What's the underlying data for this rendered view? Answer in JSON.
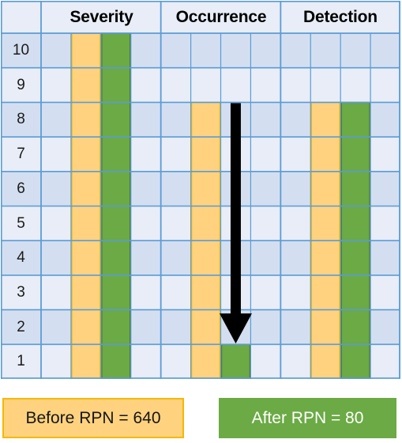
{
  "chart_data": {
    "type": "bar",
    "title": "",
    "xlabel": "",
    "ylabel": "",
    "ylim": [
      0,
      10
    ],
    "grid": true,
    "legend_position": "bottom",
    "categories": [
      "Severity",
      "Occurrence",
      "Detection"
    ],
    "tick_labels": [
      "10",
      "9",
      "8",
      "7",
      "6",
      "5",
      "4",
      "3",
      "2",
      "1"
    ],
    "series": [
      {
        "name": "Before RPN = 640",
        "color": "#FFD27F",
        "values": [
          10,
          8,
          8
        ]
      },
      {
        "name": "After RPN = 80",
        "color": "#6BAA45",
        "values": [
          10,
          1,
          8
        ]
      }
    ],
    "annotations": [
      {
        "type": "down-arrow",
        "category": "Occurrence",
        "series": "After RPN = 80",
        "from_value": 8,
        "to_value": 1,
        "color": "#000000"
      }
    ],
    "computed": {
      "before_rpn": 640,
      "after_rpn": 80
    }
  },
  "header": {
    "corner_label": "",
    "columns": [
      {
        "label": "Severity"
      },
      {
        "label": "Occurrence"
      },
      {
        "label": "Detection"
      }
    ]
  },
  "axis": {
    "row_labels": [
      "10",
      "9",
      "8",
      "7",
      "6",
      "5",
      "4",
      "3",
      "2",
      "1"
    ]
  },
  "legend": {
    "before": {
      "label": "Before RPN = 640",
      "fill": "#FFD27F",
      "stroke": "#F5B800",
      "text_color": "#161616"
    },
    "after": {
      "label": "After RPN = 80",
      "fill": "#6BAA45",
      "stroke": "#6BAA45",
      "text_color": "#FFFFFF"
    }
  },
  "theme": {
    "gridline": "#5B9BD5",
    "row_dark": "#D3DFF0",
    "row_light": "#E8EDF7",
    "header_bg": "#E8EDF7",
    "bar_orange": "#FFD27F",
    "bar_orange_edge": "#F5B800",
    "bar_green": "#6BAA45",
    "bar_green_edge": "#4E7A31",
    "arrow": "#000000"
  }
}
